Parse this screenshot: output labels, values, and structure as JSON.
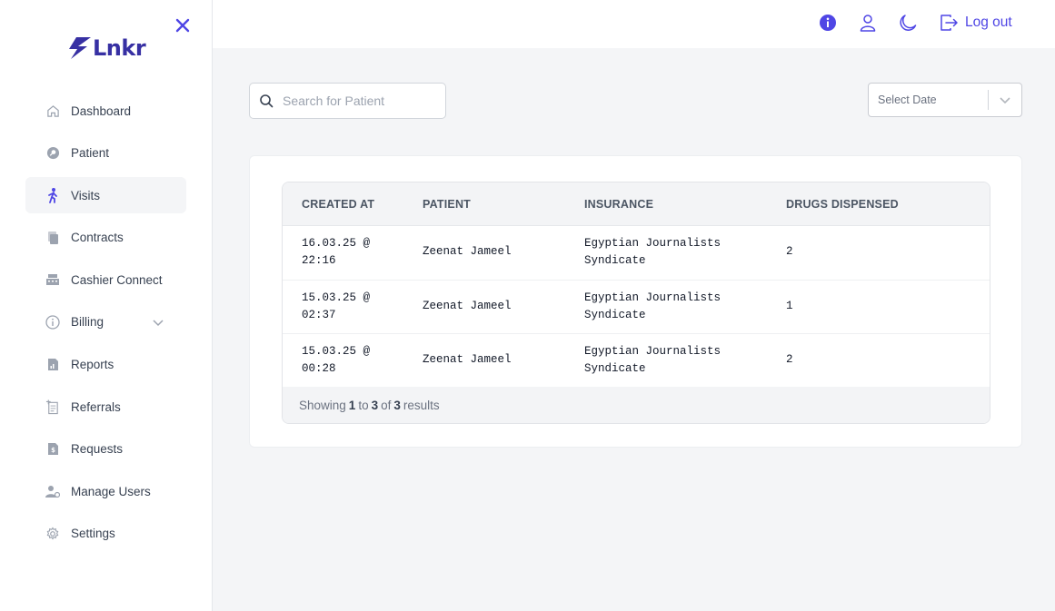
{
  "brand": {
    "name": "Lnkr",
    "color": "#4f46e5"
  },
  "sidebar": {
    "items": [
      {
        "label": "Dashboard",
        "icon": "home-icon"
      },
      {
        "label": "Patient",
        "icon": "patient-search-icon"
      },
      {
        "label": "Visits",
        "icon": "walking-person-icon",
        "active": true
      },
      {
        "label": "Contracts",
        "icon": "documents-icon"
      },
      {
        "label": "Cashier Connect",
        "icon": "cash-register-icon"
      },
      {
        "label": "Billing",
        "icon": "info-circle-icon",
        "expandable": true
      },
      {
        "label": "Reports",
        "icon": "report-icon"
      },
      {
        "label": "Referrals",
        "icon": "referrals-icon"
      },
      {
        "label": "Requests",
        "icon": "request-doc-icon"
      },
      {
        "label": "Manage Users",
        "icon": "users-gear-icon"
      },
      {
        "label": "Settings",
        "icon": "gear-icon"
      }
    ]
  },
  "header": {
    "logout_label": "Log out"
  },
  "search": {
    "placeholder": "Search for Patient",
    "value": ""
  },
  "date_filter": {
    "placeholder": "Select Date"
  },
  "table": {
    "columns": [
      "CREATED AT",
      "PATIENT",
      "INSURANCE",
      "DRUGS DISPENSED"
    ],
    "rows": [
      {
        "created_at": "16.03.25 @ 22:16",
        "patient": "Zeenat Jameel",
        "insurance": "Egyptian Journalists Syndicate",
        "drugs": "2"
      },
      {
        "created_at": "15.03.25 @ 02:37",
        "patient": "Zeenat Jameel",
        "insurance": "Egyptian Journalists Syndicate",
        "drugs": "1"
      },
      {
        "created_at": "15.03.25 @ 00:28",
        "patient": "Zeenat Jameel",
        "insurance": "Egyptian Journalists Syndicate",
        "drugs": "2"
      }
    ],
    "footer": {
      "prefix": "Showing",
      "from": "1",
      "to_word": "to",
      "to": "3",
      "of_word": "of",
      "total": "3",
      "suffix": "results"
    }
  }
}
